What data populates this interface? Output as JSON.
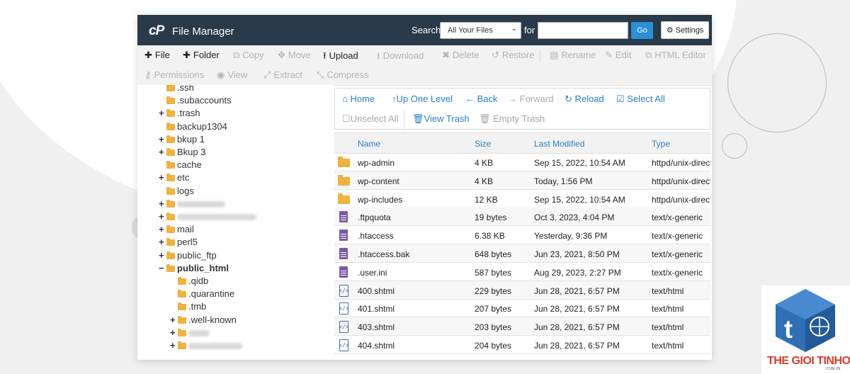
{
  "header": {
    "logo": "cP",
    "title": "File Manager",
    "search_label": "Search",
    "search_scope": "All Your Files",
    "for_label": "for",
    "search_value": "",
    "go_label": "Go",
    "settings_label": "Settings"
  },
  "toolbar": {
    "row1": [
      {
        "icon": "plus-icon",
        "glyph": "✚",
        "label": "File",
        "enabled": true
      },
      {
        "icon": "plus-icon",
        "glyph": "✚",
        "label": "Folder",
        "enabled": true
      },
      {
        "icon": "copy-icon",
        "glyph": "⧉",
        "label": "Copy",
        "enabled": false
      },
      {
        "icon": "move-icon",
        "glyph": "✥",
        "label": "Move",
        "enabled": false
      },
      {
        "icon": "upload-icon",
        "glyph": "⭱",
        "label": "Upload",
        "enabled": true
      },
      {
        "icon": "download-icon",
        "glyph": "⭳",
        "label": "Download",
        "enabled": false
      },
      {
        "icon": "delete-icon",
        "glyph": "✖",
        "label": "Delete",
        "enabled": false
      },
      {
        "icon": "restore-icon",
        "glyph": "↺",
        "label": "Restore",
        "enabled": false
      },
      {
        "icon": "rename-icon",
        "glyph": "▤",
        "label": "Rename",
        "enabled": false
      },
      {
        "icon": "edit-icon",
        "glyph": "✎",
        "label": "Edit",
        "enabled": false
      },
      {
        "icon": "html-editor-icon",
        "glyph": "⧉",
        "label": "HTML Editor",
        "enabled": false
      }
    ],
    "row2": [
      {
        "icon": "key-icon",
        "glyph": "⚷",
        "label": "Permissions",
        "enabled": false
      },
      {
        "icon": "eye-icon",
        "glyph": "◉",
        "label": "View",
        "enabled": false
      },
      {
        "icon": "extract-icon",
        "glyph": "⤢",
        "label": "Extract",
        "enabled": false
      },
      {
        "icon": "compress-icon",
        "glyph": "⤡",
        "label": "Compress",
        "enabled": false
      }
    ]
  },
  "tree": [
    {
      "label": ".ssh",
      "expander": "",
      "level": 1
    },
    {
      "label": ".subaccounts",
      "expander": "",
      "level": 1
    },
    {
      "label": ".trash",
      "expander": "+",
      "level": 1
    },
    {
      "label": "backup1304",
      "expander": "",
      "level": 1
    },
    {
      "label": "bkup 1",
      "expander": "+",
      "level": 1
    },
    {
      "label": "Bkup 3",
      "expander": "+",
      "level": 1
    },
    {
      "label": "cache",
      "expander": "",
      "level": 1
    },
    {
      "label": "etc",
      "expander": "+",
      "level": 1
    },
    {
      "label": "logs",
      "expander": "",
      "level": 1
    },
    {
      "label": "",
      "expander": "+",
      "level": 1,
      "blurred": true,
      "blur_width": 68
    },
    {
      "label": "",
      "expander": "+",
      "level": 1,
      "blurred": true,
      "blur_width": 112
    },
    {
      "label": "mail",
      "expander": "+",
      "level": 1
    },
    {
      "label": "perl5",
      "expander": "+",
      "level": 1
    },
    {
      "label": "public_ftp",
      "expander": "+",
      "level": 1
    },
    {
      "label": "public_html",
      "expander": "−",
      "level": 1,
      "open": true,
      "bold": true
    },
    {
      "label": ".qidb",
      "expander": "",
      "level": 2
    },
    {
      "label": ".quarantine",
      "expander": "",
      "level": 2
    },
    {
      "label": ".tmb",
      "expander": "",
      "level": 2
    },
    {
      "label": ".well-known",
      "expander": "+",
      "level": 2
    },
    {
      "label": "",
      "expander": "+",
      "level": 2,
      "blurred": true,
      "blur_width": 30
    },
    {
      "label": "",
      "expander": "+",
      "level": 2,
      "blurred": true,
      "blur_width": 76
    }
  ],
  "nav": {
    "home": "Home",
    "up": "Up One Level",
    "back": "Back",
    "forward": "Forward",
    "reload": "Reload",
    "select_all": "Select All",
    "unselect_all": "Unselect All",
    "view_trash": "View Trash",
    "empty_trash": "Empty Trash"
  },
  "table": {
    "columns": [
      "Name",
      "Size",
      "Last Modified",
      "Type"
    ],
    "rows": [
      {
        "icon": "folder",
        "name": "wp-admin",
        "size": "4 KB",
        "modified": "Sep 15, 2022, 10:54 AM",
        "type": "httpd/unix-direct"
      },
      {
        "icon": "folder",
        "name": "wp-content",
        "size": "4 KB",
        "modified": "Today, 1:56 PM",
        "type": "httpd/unix-direct"
      },
      {
        "icon": "folder",
        "name": "wp-includes",
        "size": "12 KB",
        "modified": "Sep 15, 2022, 10:54 AM",
        "type": "httpd/unix-direct"
      },
      {
        "icon": "text",
        "name": ".ftpquota",
        "size": "19 bytes",
        "modified": "Oct 3, 2023, 4:04 PM",
        "type": "text/x-generic"
      },
      {
        "icon": "text",
        "name": ".htaccess",
        "size": "6.38 KB",
        "modified": "Yesterday, 9:36 PM",
        "type": "text/x-generic"
      },
      {
        "icon": "text",
        "name": ".htaccess.bak",
        "size": "648 bytes",
        "modified": "Jun 23, 2021, 8:50 PM",
        "type": "text/x-generic"
      },
      {
        "icon": "text",
        "name": ".user.ini",
        "size": "587 bytes",
        "modified": "Aug 29, 2023, 2:27 PM",
        "type": "text/x-generic"
      },
      {
        "icon": "html",
        "name": "400.shtml",
        "size": "229 bytes",
        "modified": "Jun 28, 2021, 6:57 PM",
        "type": "text/html"
      },
      {
        "icon": "html",
        "name": "401.shtml",
        "size": "207 bytes",
        "modified": "Jun 28, 2021, 6:57 PM",
        "type": "text/html"
      },
      {
        "icon": "html",
        "name": "403.shtml",
        "size": "203 bytes",
        "modified": "Jun 28, 2021, 6:57 PM",
        "type": "text/html"
      },
      {
        "icon": "html",
        "name": "404.shtml",
        "size": "204 bytes",
        "modified": "Jun 28, 2021, 6:57 PM",
        "type": "text/html"
      }
    ]
  },
  "brand": {
    "name": "THE GIOI TINHOC",
    "sub": ".COM.VN",
    "colors": {
      "primary": "#2f6fb5",
      "accent": "#d93a2b"
    }
  },
  "colors": {
    "header_bg": "#293a4a",
    "link": "#2a7fc8",
    "go_button": "#2a8fd6",
    "folder": "#f0b23e",
    "text_file": "#7a5aa5"
  }
}
